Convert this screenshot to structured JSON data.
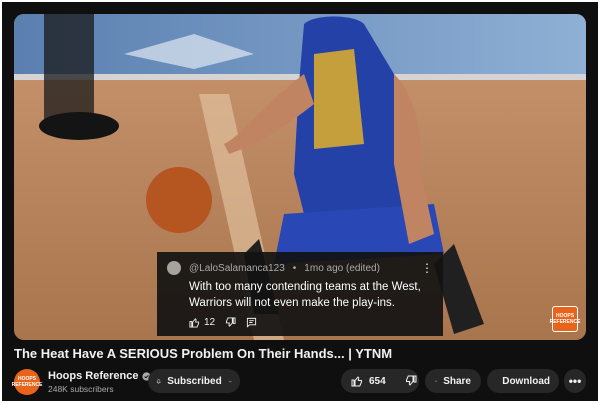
{
  "comment": {
    "author": "@LaloSalamanca123",
    "time": "1mo ago (edited)",
    "text": "With too many contending teams at the West,\nWarriors will not even make the play-ins.",
    "likes": "12"
  },
  "watermark": {
    "text": "HOOPS REFERENCE"
  },
  "video": {
    "title": "The Heat Have A SERIOUS Problem On Their Hands... | YTNM"
  },
  "channel": {
    "name": "Hoops Reference",
    "subscribers": "248K subscribers",
    "avatar_text": "HOOPS REFERENCE"
  },
  "actions": {
    "subscribed_label": "Subscribed",
    "like_count": "654",
    "share_label": "Share",
    "download_label": "Download"
  },
  "colors": {
    "accent": "#e8641b",
    "background": "#0f0f0f",
    "pill": "#272727"
  }
}
